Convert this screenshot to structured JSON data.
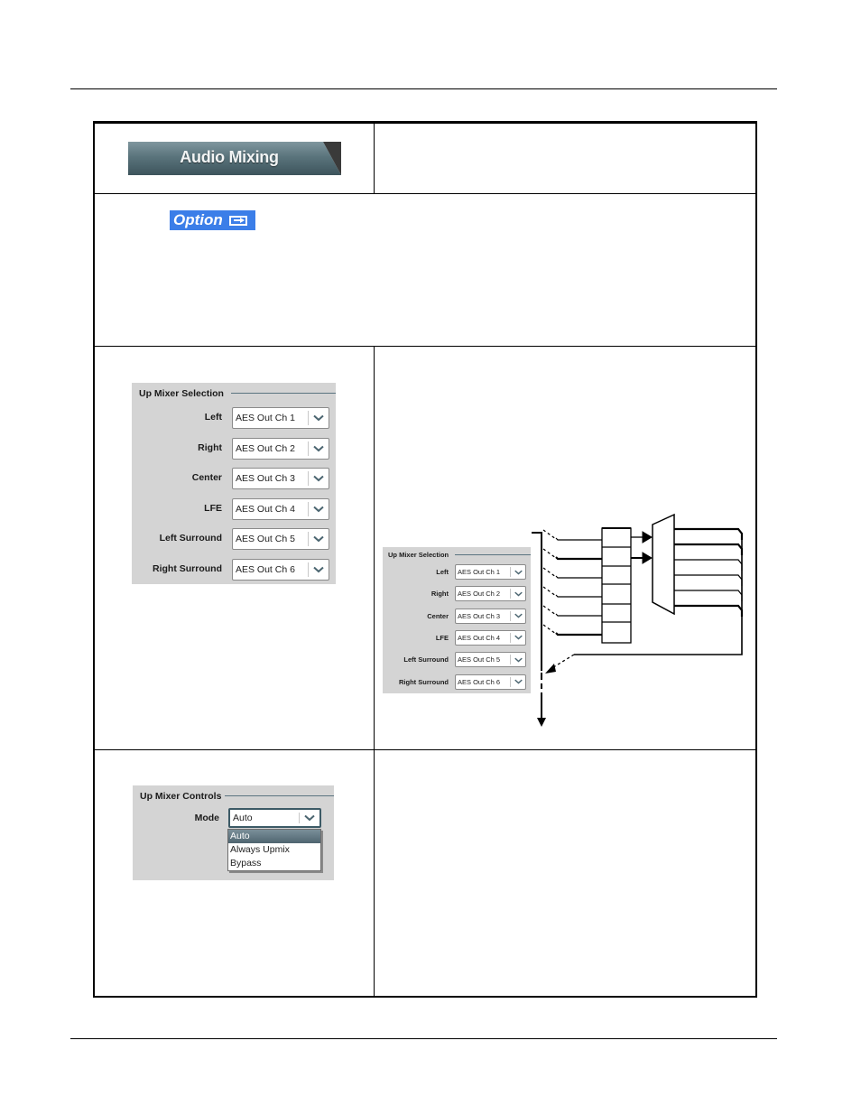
{
  "header_tab": {
    "label": "Audio Mixing"
  },
  "option_badge": {
    "label": "Option",
    "icon": "arrow-right-box-icon"
  },
  "upmixer_selection": {
    "title": "Up Mixer Selection",
    "fields": [
      {
        "label": "Left",
        "value": "AES Out Ch 1"
      },
      {
        "label": "Right",
        "value": "AES Out Ch 2"
      },
      {
        "label": "Center",
        "value": "AES Out Ch 3"
      },
      {
        "label": "LFE",
        "value": "AES Out Ch 4"
      },
      {
        "label": "Left Surround",
        "value": "AES Out Ch 5"
      },
      {
        "label": "Right Surround",
        "value": "AES Out Ch 6"
      }
    ]
  },
  "upmixer_controls": {
    "title": "Up Mixer Controls",
    "mode_label": "Mode",
    "mode_value": "Auto",
    "mode_options": [
      "Auto",
      "Always Upmix",
      "Bypass"
    ],
    "selected_option": "Auto"
  },
  "colors": {
    "option_badge": "#3b7ee8",
    "panel_bg": "#d4d4d4",
    "tab_bg": "#4e6a73"
  }
}
